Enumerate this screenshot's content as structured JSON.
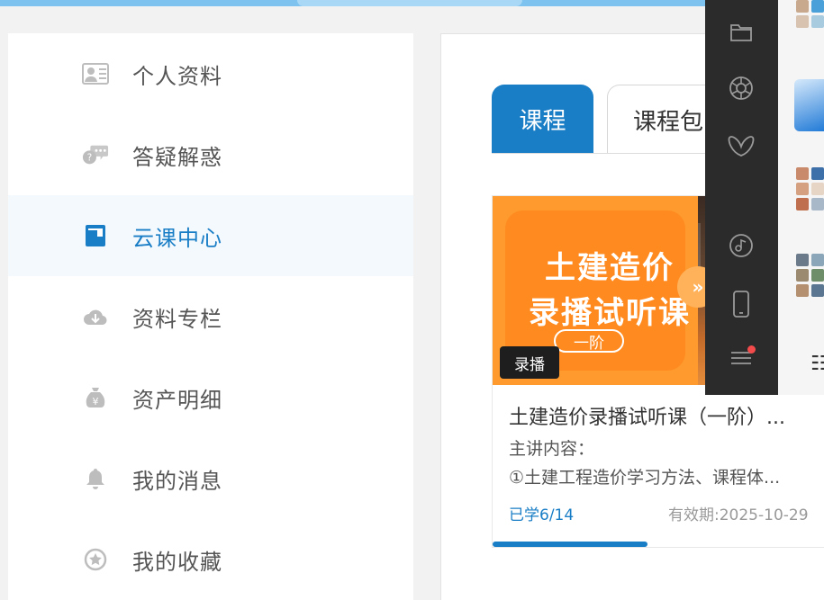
{
  "sidebar": {
    "items": [
      {
        "label": "个人资料",
        "icon": "profile-card-icon",
        "active": false
      },
      {
        "label": "答疑解惑",
        "icon": "chat-question-icon",
        "active": false
      },
      {
        "label": "云课中心",
        "icon": "course-book-icon",
        "active": true
      },
      {
        "label": "资料专栏",
        "icon": "cloud-download-icon",
        "active": false
      },
      {
        "label": "资产明细",
        "icon": "money-bag-icon",
        "active": false
      },
      {
        "label": "我的消息",
        "icon": "bell-icon",
        "active": false
      },
      {
        "label": "我的收藏",
        "icon": "star-circle-icon",
        "active": false
      }
    ]
  },
  "tabs": [
    {
      "label": "课程",
      "active": true
    },
    {
      "label": "课程包",
      "active": false
    }
  ],
  "course_card": {
    "thumbnail_line1": "土建造价",
    "thumbnail_line2": "录播试听课",
    "thumbnail_tag": "一阶",
    "thumbnail_arrow": "»",
    "badge": "录播",
    "title": "土建造价录播试听课（一阶）...",
    "desc_label": "主讲内容：",
    "desc": "①土建工程造价学习方法、课程体...",
    "learned": "已学6/14",
    "progress_fraction": 0.4286,
    "validity_label": "有效期:",
    "validity_date": "2025-10-29"
  },
  "dock": {
    "items": [
      "folder-icon",
      "aperture-icon",
      "butterfly-icon",
      "music-disc-icon",
      "phone-icon",
      "menu-icon"
    ],
    "menu_has_notification": true
  },
  "colors": {
    "accent": "#1a7ec6",
    "thumbnail_orange": "#ff9a2e",
    "dock_bg": "#2b2b2b",
    "notification_dot": "#f34b4b"
  }
}
